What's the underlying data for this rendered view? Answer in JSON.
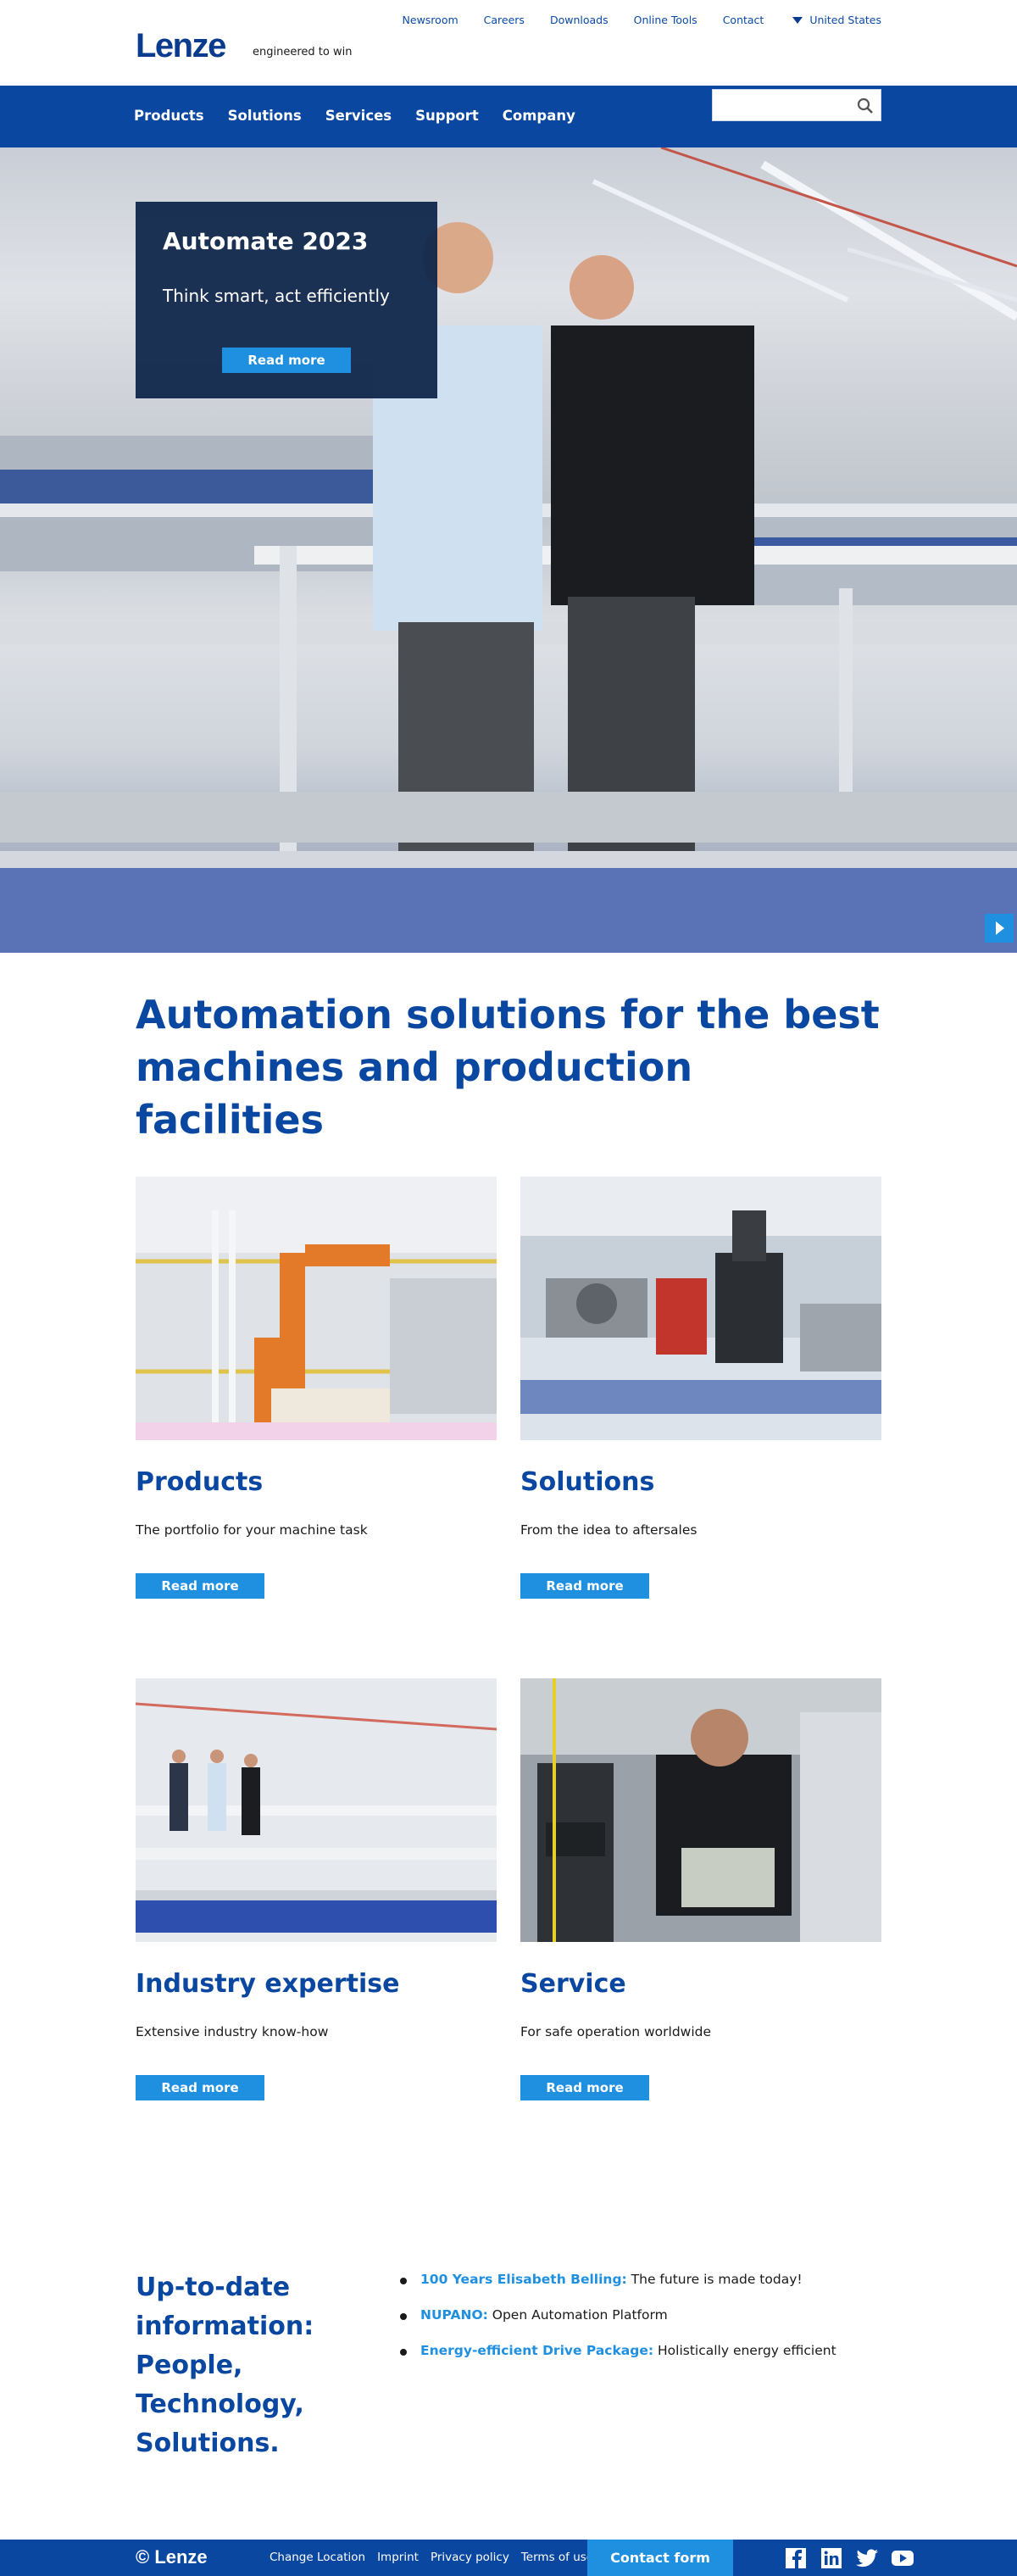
{
  "header": {
    "logo": "Lenze",
    "tagline": "engineered to win",
    "top_links": [
      "Newsroom",
      "Careers",
      "Downloads",
      "Online Tools",
      "Contact"
    ],
    "location": "United States"
  },
  "nav": {
    "items": [
      "Products",
      "Solutions",
      "Services",
      "Support",
      "Company"
    ],
    "search_placeholder": ""
  },
  "hero": {
    "title": "Automate 2023",
    "subtitle": "Think smart, act efficiently",
    "button": "Read more"
  },
  "intro": {
    "headline": "Automation solutions for the best machines and production facilities"
  },
  "cards": [
    {
      "title": "Products",
      "text": "The portfolio for your machine task",
      "button": "Read more"
    },
    {
      "title": "Solutions",
      "text": "From the idea to aftersales",
      "button": "Read more"
    },
    {
      "title": "Industry expertise",
      "text": "Extensive industry know-how",
      "button": "Read more"
    },
    {
      "title": "Service",
      "text": "For safe operation worldwide",
      "button": "Read more"
    }
  ],
  "info": {
    "title": "Up-to-date information: People, Technology, Solutions.",
    "items": [
      {
        "link": "100 Years Elisabeth Belling:",
        "text": " The future is made today!"
      },
      {
        "link": "NUPANO:",
        "text": " Open Automation Platform"
      },
      {
        "link": "Energy-efficient Drive Package:",
        "text": " Holistically energy efficient"
      }
    ]
  },
  "footer": {
    "logo": "© Lenze",
    "links": [
      "Change Location",
      "Imprint",
      "Privacy policy",
      "Terms of use"
    ],
    "contact": "Contact form",
    "social": [
      "f",
      "in",
      "t",
      "yt"
    ]
  },
  "colors": {
    "brand": "#0a47a1",
    "accent": "#1f8fe0"
  }
}
